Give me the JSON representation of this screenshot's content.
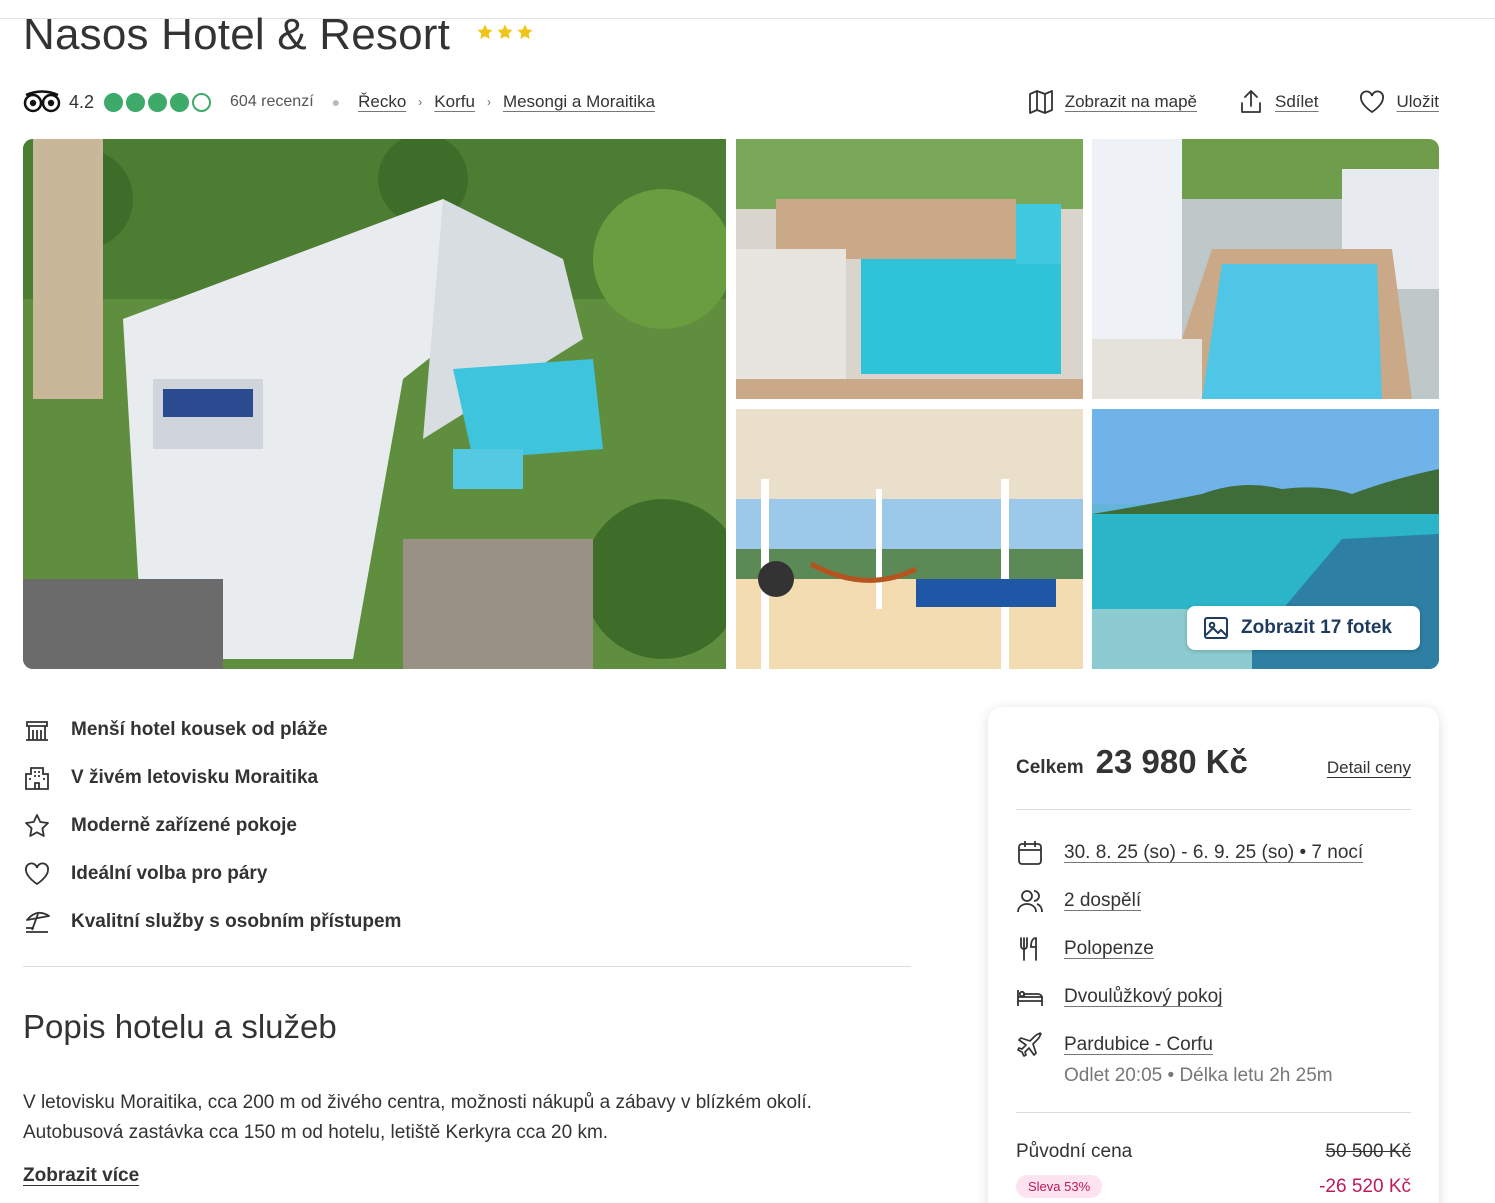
{
  "hotel": {
    "name": "Nasos Hotel & Resort",
    "stars": 3,
    "star_color": "#f0c419"
  },
  "meta": {
    "rating": "4.2",
    "rating_bubbles_filled": 4,
    "rating_bubbles_total": 5,
    "rating_color": "#3daa6a",
    "reviews": "604 recenzí",
    "breadcrumb": [
      "Řecko",
      "Korfu",
      "Mesongi a Moraitika"
    ]
  },
  "actions": {
    "map": "Zobrazit na mapě",
    "share": "Sdílet",
    "save": "Uložit"
  },
  "gallery": {
    "photos_button": "Zobrazit 17 fotek"
  },
  "features": [
    {
      "icon": "hotel-icon",
      "label": "Menší hotel kousek od pláže"
    },
    {
      "icon": "city-icon",
      "label": "V živém letovisku Moraitika"
    },
    {
      "icon": "star-icon",
      "label": "Moderně zařízené pokoje"
    },
    {
      "icon": "heart-icon",
      "label": "Ideální volba pro páry"
    },
    {
      "icon": "beach-icon",
      "label": "Kvalitní služby s osobním přístupem"
    }
  ],
  "description": {
    "title": "Popis hotelu a služeb",
    "text_line1": "V letovisku Moraitika, cca 200 m od živého centra, možnosti nákupů a zábavy v blízkém okolí.",
    "text_line2": "Autobusová zastávka cca 150 m od hotelu, letiště Kerkyra cca 20 km.",
    "more": "Zobrazit více"
  },
  "price": {
    "total_label": "Celkem",
    "total": "23 980 Kč",
    "detail": "Detail ceny",
    "dates": "30. 8. 25 (so) - 6. 9. 25 (so) • 7 nocí",
    "guests": "2 dospělí",
    "board": "Polopenze",
    "room": "Dvoulůžkový pokoj",
    "flight": "Pardubice - Corfu",
    "flight_info": "Odlet 20:05 • Délka letu 2h 25m",
    "original_label": "Původní cena",
    "original": "50 500 Kč",
    "discount_badge": "Sleva 53%",
    "discount": "-26 520 Kč",
    "discount_color": "#c0185c"
  }
}
